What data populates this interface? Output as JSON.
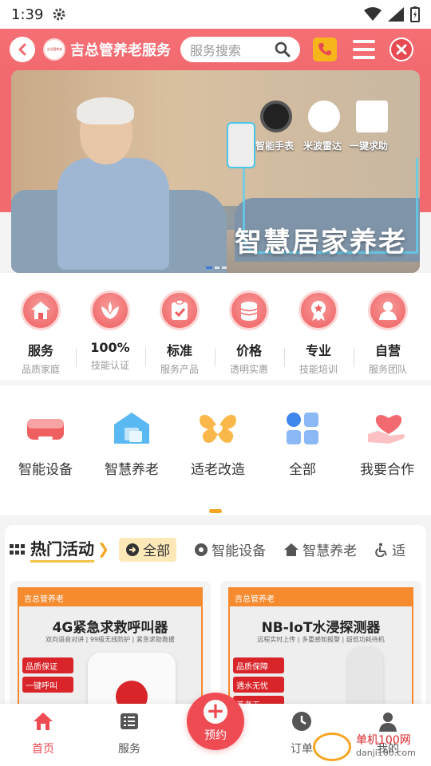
{
  "status": {
    "time": "1:39"
  },
  "header": {
    "logo_text": "吉总管养老",
    "title": "吉总管养老服务",
    "search_placeholder": "服务搜索"
  },
  "banner": {
    "products": [
      "智能手表",
      "米波雷达",
      "一键求助"
    ],
    "slogan": "智慧居家养老",
    "page_count": 3,
    "current_page": 1
  },
  "features": [
    {
      "title": "服务",
      "sub": "品质家庭",
      "icon": "home-icon"
    },
    {
      "title": "100%",
      "sub": "技能认证",
      "icon": "lotus-icon"
    },
    {
      "title": "标准",
      "sub": "服务产品",
      "icon": "clipboard-icon"
    },
    {
      "title": "价格",
      "sub": "透明实惠",
      "icon": "coins-icon"
    },
    {
      "title": "专业",
      "sub": "技能培训",
      "icon": "medal-icon"
    },
    {
      "title": "自营",
      "sub": "服务团队",
      "icon": "team-icon"
    }
  ],
  "categories": [
    {
      "label": "智能设备",
      "icon": "smart-device-icon"
    },
    {
      "label": "智慧养老",
      "icon": "smart-home-icon"
    },
    {
      "label": "适老改造",
      "icon": "butterfly-heart-icon"
    },
    {
      "label": "全部",
      "icon": "grid-icon"
    },
    {
      "label": "我要合作",
      "icon": "hand-heart-icon"
    }
  ],
  "hot": {
    "title": "热门活动",
    "tabs": [
      "全部",
      "智能设备",
      "智慧养老",
      "适"
    ],
    "cards": [
      {
        "brand": "吉总管养老",
        "title": "4G紧急求救呼叫器",
        "subtitle": "双向语音对讲 | 99级无线防护 | 紧急求助救援",
        "badges": [
          "品质保证",
          "一键呼叫"
        ]
      },
      {
        "brand": "吉总管养老",
        "title": "NB-IoT水浸探测器",
        "subtitle": "远程实时上传 | 多重感知报警 | 超低功耗待机",
        "badges": [
          "品质保障",
          "遇水无忧",
          "养老无"
        ]
      }
    ]
  },
  "nav": {
    "items": [
      "首页",
      "服务",
      "订单",
      "我的"
    ],
    "fab_label": "预约",
    "active": "首页"
  },
  "watermark": {
    "line1": "单机100网",
    "line2": "danji100.com"
  },
  "colors": {
    "brand": "#f26a70",
    "accent": "#f5a623",
    "cta": "#ef4b53"
  }
}
